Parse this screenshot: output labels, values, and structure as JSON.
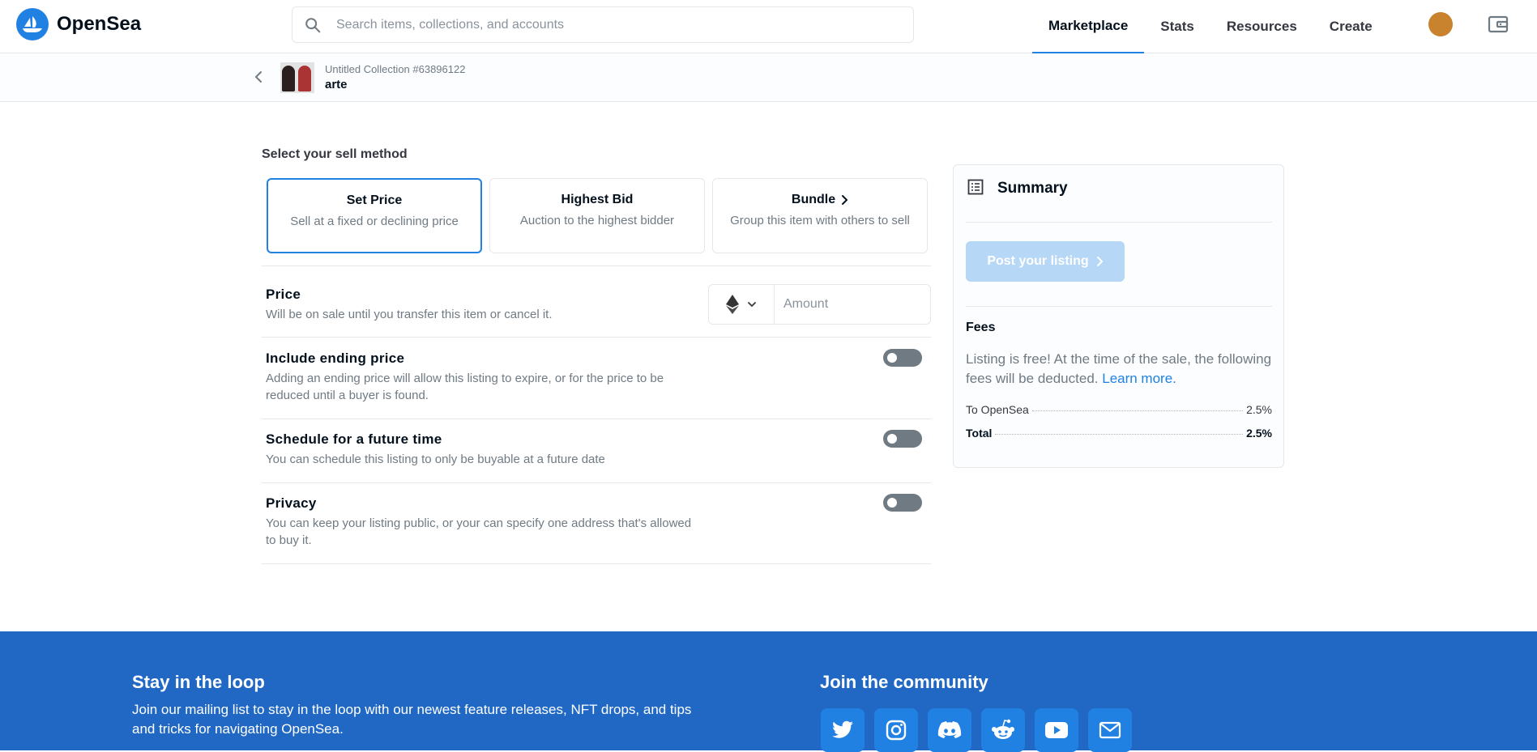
{
  "header": {
    "brand": "OpenSea",
    "search_placeholder": "Search items, collections, and accounts",
    "nav": [
      {
        "label": "Marketplace",
        "active": true
      },
      {
        "label": "Stats",
        "active": false
      },
      {
        "label": "Resources",
        "active": false
      },
      {
        "label": "Create",
        "active": false
      }
    ]
  },
  "item": {
    "collection": "Untitled Collection #63896122",
    "name": "arte"
  },
  "sell": {
    "title": "Select your sell method",
    "methods": [
      {
        "title": "Set Price",
        "desc": "Sell at a fixed or declining price",
        "selected": true
      },
      {
        "title": "Highest Bid",
        "desc": "Auction to the highest bidder",
        "selected": false
      },
      {
        "title": "Bundle",
        "desc": "Group this item with others to sell",
        "selected": false
      }
    ],
    "price": {
      "title": "Price",
      "desc": "Will be on sale until you transfer this item or cancel it.",
      "amount_placeholder": "Amount"
    },
    "options": [
      {
        "title": "Include ending price",
        "desc": "Adding an ending price will allow this listing to expire, or for the price to be reduced until a buyer is found.",
        "enabled": false
      },
      {
        "title": "Schedule for a future time",
        "desc": "You can schedule this listing to only be buyable at a future date",
        "enabled": false
      },
      {
        "title": "Privacy",
        "desc": "You can keep your listing public, or your can specify one address that's allowed to buy it.",
        "enabled": false
      }
    ]
  },
  "summary": {
    "title": "Summary",
    "post_label": "Post your listing",
    "fees_title": "Fees",
    "fees_text": "Listing is free! At the time of the sale, the following fees will be deducted.",
    "learn_more": "Learn more.",
    "fees": [
      {
        "label": "To OpenSea",
        "value": "2.5%"
      },
      {
        "label": "Total",
        "value": "2.5%"
      }
    ]
  },
  "footer": {
    "loop_title": "Stay in the loop",
    "loop_text": "Join our mailing list to stay in the loop with our newest feature releases, NFT drops, and tips and tricks for navigating OpenSea.",
    "community_title": "Join the community"
  },
  "colors": {
    "accent": "#2081e2",
    "footer": "#2068c4",
    "toggle_off": "#707a83"
  }
}
